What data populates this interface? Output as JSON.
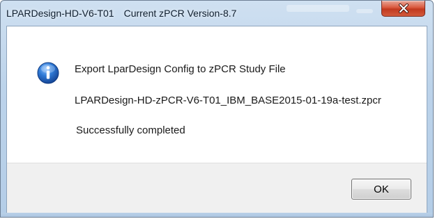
{
  "window": {
    "title_app": "LPARDesign-HD-V6-T01",
    "title_version": "Current zPCR Version-8.7",
    "close_icon": "close-icon"
  },
  "dialog": {
    "icon": "info-icon",
    "message_heading": "Export LparDesign Config to zPCR Study File",
    "file_name": "LPARDesign-HD-zPCR-V6-T01_IBM_BASE2015-01-19a-test.zpcr",
    "status": "Successfully completed"
  },
  "buttons": {
    "ok_label": "OK"
  },
  "colors": {
    "title_glass": "#bcd3ea",
    "close_red": "#c13a1f",
    "info_blue": "#1f5fbf",
    "footer_gray": "#f0f0f0"
  }
}
